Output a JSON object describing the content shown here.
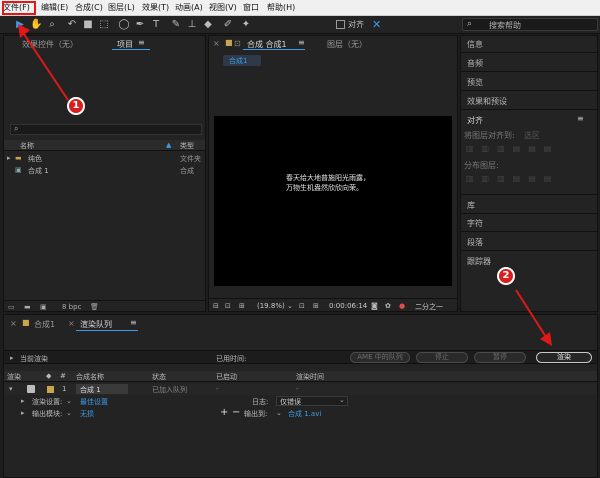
{
  "menubar": {
    "items": [
      "文件(F)",
      "编辑(E)",
      "合成(C)",
      "图层(L)",
      "效果(T)",
      "动画(A)",
      "视图(V)",
      "窗口",
      "帮助(H)"
    ]
  },
  "toolbar": {
    "snap_label": "对齐",
    "search_placeholder": "搜索帮助"
  },
  "project_panel": {
    "tab_effects": "效果控件（无）",
    "tab_project": "项目",
    "col_name": "名称",
    "col_type": "类型",
    "items": [
      {
        "name": "纯色",
        "type": "文件夹"
      },
      {
        "name": "合成 1",
        "type": "合成"
      }
    ],
    "bpc": "8 bpc"
  },
  "comp_panel": {
    "tab_comp": "合成 合成1",
    "tab_layer": "图层（无）",
    "breadcrumb": "合成1",
    "text_line1": "春天给大地普施阳光雨露，",
    "text_line2": "万物生机盎然欣欣向荣。",
    "zoom": "(19.8%)",
    "timecode": "0:00:06:14",
    "resolution": "二分之一"
  },
  "right_panel": {
    "items": [
      "信息",
      "音频",
      "预览",
      "效果和预设",
      "对齐",
      "将图层对齐到:",
      "选区",
      "分布图层:",
      "库",
      "字符",
      "段落",
      "跟踪器"
    ]
  },
  "bottom_panel": {
    "tab_comp": "合成1",
    "tab_render": "渲染队列",
    "current_render": "当前渲染",
    "elapsed": "已用时间:",
    "ame_btn": "AME 中的队列",
    "stop_btn": "停止",
    "pause_btn": "暂停",
    "render_btn": "渲染",
    "headers": [
      "渲染",
      "#",
      "合成名称",
      "状态",
      "已启动",
      "渲染时间"
    ],
    "row": {
      "num": "1",
      "name": "合成 1",
      "status": "已加入队列",
      "started": "-",
      "time": "-"
    },
    "settings_label": "渲染设置:",
    "settings_value": "最佳设置",
    "log_label": "日志:",
    "log_value": "仅错误",
    "output_label": "输出模块:",
    "output_value": "无损",
    "output_to_label": "输出到:",
    "output_to_value": "合成 1.avi"
  },
  "annotations": {
    "badge1": "1",
    "badge2": "2"
  }
}
